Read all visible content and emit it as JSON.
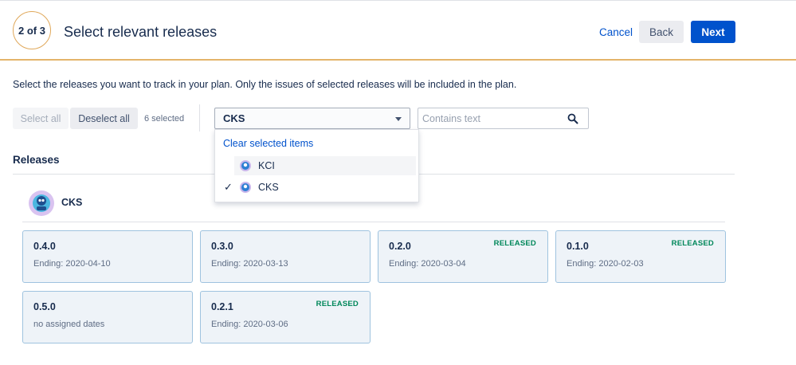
{
  "header": {
    "step": "2 of 3",
    "title": "Select relevant releases",
    "cancel_label": "Cancel",
    "back_label": "Back",
    "next_label": "Next"
  },
  "instructions": "Select the releases you want to track in your plan. Only the issues of selected releases will be included in the plan.",
  "toolbar": {
    "select_all_label": "Select all",
    "deselect_all_label": "Deselect all",
    "selected_count": "6 selected",
    "project_filter_value": "CKS",
    "search_placeholder": "Contains text"
  },
  "dropdown": {
    "clear_label": "Clear selected items",
    "options": [
      {
        "label": "KCI",
        "checked": false
      },
      {
        "label": "CKS",
        "checked": true
      }
    ]
  },
  "releases": {
    "title": "Releases",
    "project_name": "CKS",
    "cards": [
      {
        "name": "0.4.0",
        "date": "Ending: 2020-04-10",
        "badge": ""
      },
      {
        "name": "0.3.0",
        "date": "Ending: 2020-03-13",
        "badge": ""
      },
      {
        "name": "0.2.0",
        "date": "Ending: 2020-03-04",
        "badge": "RELEASED"
      },
      {
        "name": "0.1.0",
        "date": "Ending: 2020-02-03",
        "badge": "RELEASED"
      },
      {
        "name": "0.5.0",
        "date": "no assigned dates",
        "badge": ""
      },
      {
        "name": "0.2.1",
        "date": "Ending: 2020-03-06",
        "badge": "RELEASED"
      }
    ]
  },
  "colors": {
    "accent": "#0052cc",
    "step_accent": "#e4b46a",
    "released": "#00875a",
    "card_border": "#9fc3df",
    "card_bg": "#eef3f8"
  },
  "icons": {
    "caret": "chevron-down-icon",
    "search": "search-icon",
    "check": "check-icon",
    "project": "project-avatar-icon"
  }
}
